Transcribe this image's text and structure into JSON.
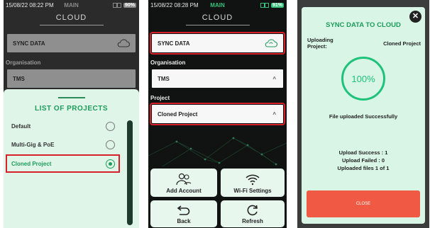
{
  "panel1": {
    "status": {
      "time": "15/08/22 08:22 PM",
      "mode": "MAIN",
      "battery": "90%"
    },
    "header": "CLOUD",
    "sync_label": "SYNC DATA",
    "org_label": "Organisation",
    "org_value": "TMS",
    "sheet_title": "LIST OF PROJECTS",
    "projects": [
      {
        "name": "Default",
        "selected": false
      },
      {
        "name": "Multi-Gig & PoE",
        "selected": false
      },
      {
        "name": "Cloned Project",
        "selected": true
      }
    ]
  },
  "panel2": {
    "status": {
      "time": "15/08/22 08:28 PM",
      "mode": "MAIN",
      "battery": "91%"
    },
    "header": "CLOUD",
    "sync_label": "SYNC DATA",
    "org_label": "Organisation",
    "org_value": "TMS",
    "project_label": "Project",
    "project_value": "Cloned Project",
    "tiles": {
      "add_account": "Add Account",
      "wifi": "Wi-Fi Settings",
      "back": "Back",
      "refresh": "Refresh"
    }
  },
  "panel3": {
    "title": "SYNC DATA TO CLOUD",
    "uploading_label": "Uploading Project:",
    "uploading_value": "Cloned Project",
    "progress": "100%",
    "status_msg": "File uploaded Successfully",
    "upload_success": "Upload Success : 1",
    "upload_failed": "Upload Failed : 0",
    "uploaded_files": "Uploaded files 1 of 1",
    "close_label": "CLOSE"
  },
  "colors": {
    "accent": "#1e9c5c",
    "highlight": "#d8202b",
    "close_button": "#f05a44"
  }
}
